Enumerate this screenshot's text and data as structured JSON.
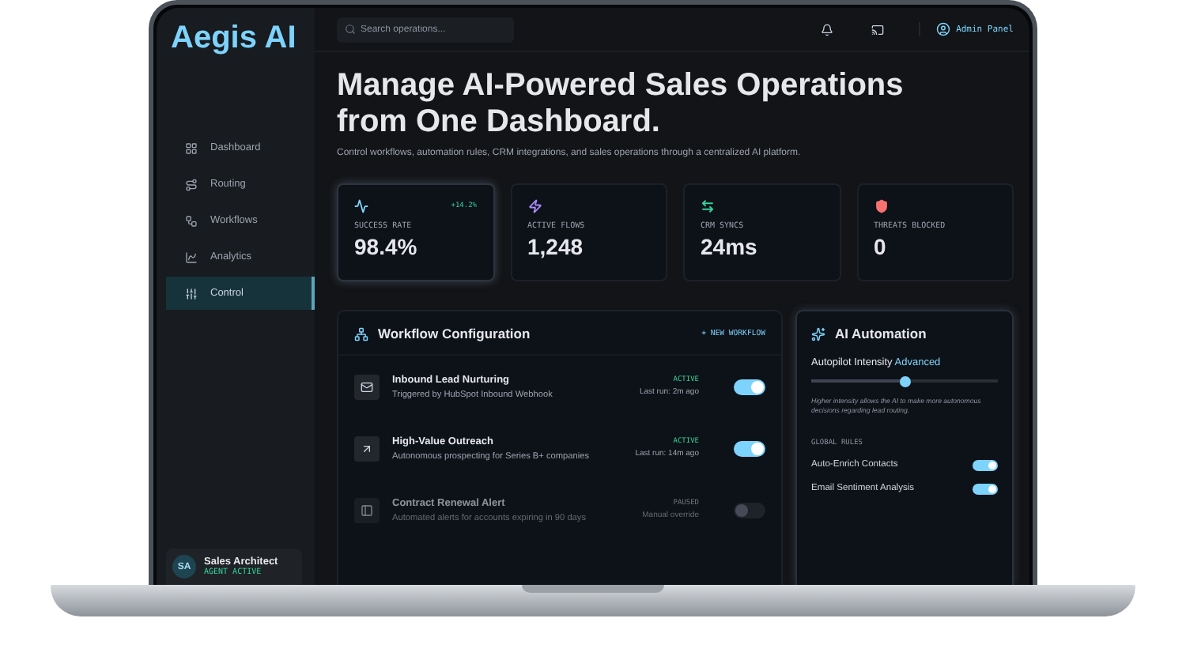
{
  "brand": "Aegis AI",
  "search": {
    "placeholder": "Search operations..."
  },
  "user": {
    "label": "Admin Panel"
  },
  "sidebar": {
    "items": [
      {
        "label": "Dashboard",
        "selected": false
      },
      {
        "label": "Routing",
        "selected": false
      },
      {
        "label": "Workflows",
        "selected": false
      },
      {
        "label": "Analytics",
        "selected": false
      },
      {
        "label": "Control",
        "selected": true
      }
    ]
  },
  "profile": {
    "initials": "SA",
    "name": "Sales Architect",
    "status": "AGENT ACTIVE"
  },
  "hero": {
    "title": "Manage AI-Powered Sales Operations from One Dashboard.",
    "subtitle": "Control workflows, automation rules, CRM integrations, and sales operations through a centralized AI platform."
  },
  "stats": [
    {
      "label": "SUCCESS RATE",
      "value": "98.4%",
      "delta": "+14.2%",
      "selected": true,
      "color": "#7dd3fc"
    },
    {
      "label": "ACTIVE FLOWS",
      "value": "1,248",
      "selected": false,
      "color": "#a78bfa"
    },
    {
      "label": "CRM SYNCS",
      "value": "24ms",
      "selected": false,
      "color": "#34d399"
    },
    {
      "label": "THREATS BLOCKED",
      "value": "0",
      "selected": false,
      "color": "#f87171"
    }
  ],
  "workflow_panel": {
    "title": "Workflow Configuration",
    "action": "+ NEW WORKFLOW",
    "workflows": [
      {
        "name": "Inbound Lead Nurturing",
        "description": "Triggered by HubSpot Inbound Webhook",
        "status": "ACTIVE",
        "last_run": "Last run: 2m ago",
        "on": true
      },
      {
        "name": "High-Value Outreach",
        "description": "Autonomous prospecting for Series B+ companies",
        "status": "ACTIVE",
        "last_run": "Last run: 14m ago",
        "on": true
      },
      {
        "name": "Contract Renewal Alert",
        "description": "Automated alerts for accounts expiring in 90 days",
        "status": "PAUSED",
        "last_run": "Manual override",
        "on": false
      }
    ]
  },
  "ai_panel": {
    "title": "AI Automation",
    "slider": {
      "label": "Autopilot Intensity",
      "value": "Advanced",
      "level": 0.5
    },
    "hint": "Higher intensity allows the AI to make more autonomous decisions regarding lead routing.",
    "rules_heading": "GLOBAL RULES",
    "rules": [
      {
        "label": "Auto-Enrich Contacts",
        "on": true
      },
      {
        "label": "Email Sentiment Analysis",
        "on": true
      }
    ]
  }
}
